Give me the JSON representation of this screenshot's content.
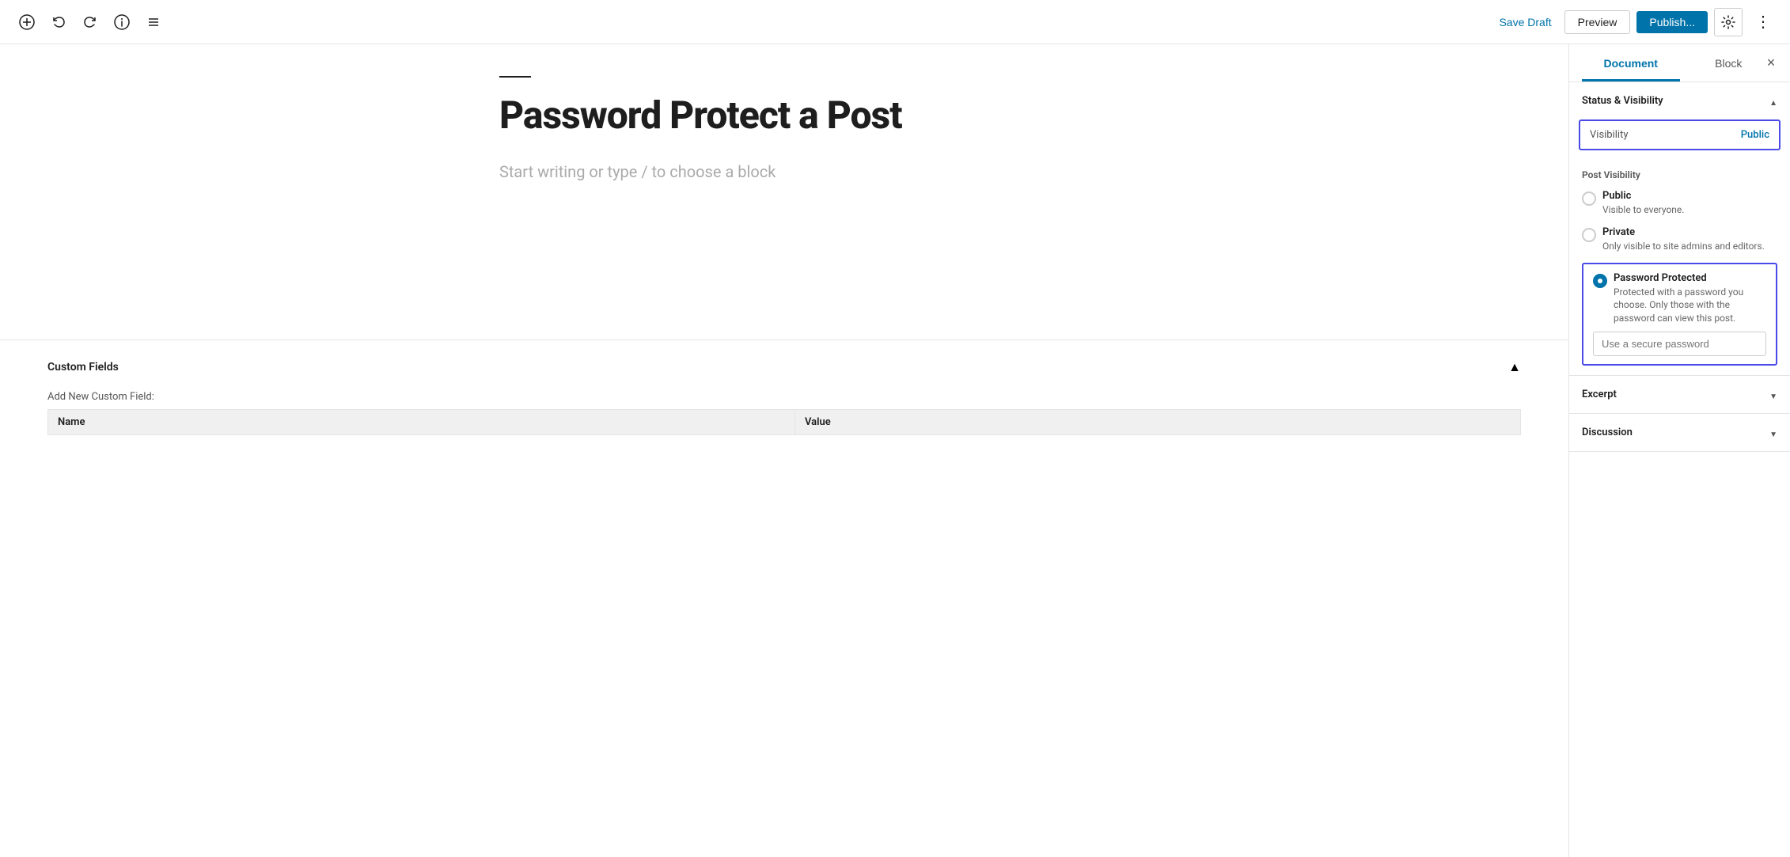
{
  "toolbar": {
    "save_draft_label": "Save Draft",
    "preview_label": "Preview",
    "publish_label": "Publish...",
    "more_label": "⋮"
  },
  "sidebar": {
    "document_tab": "Document",
    "block_tab": "Block",
    "close_label": "×",
    "status_visibility": {
      "title": "Status & Visibility",
      "visibility_label": "Visibility",
      "visibility_value": "Public",
      "post_visibility_title": "Post Visibility",
      "options": [
        {
          "id": "public",
          "title": "Public",
          "desc": "Visible to everyone.",
          "checked": false
        },
        {
          "id": "private",
          "title": "Private",
          "desc": "Only visible to site admins and editors.",
          "checked": false
        },
        {
          "id": "password",
          "title": "Password Protected",
          "desc": "Protected with a password you choose. Only those with the password can view this post.",
          "checked": true
        }
      ],
      "password_placeholder": "Use a secure password"
    },
    "excerpt": {
      "title": "Excerpt"
    },
    "discussion": {
      "title": "Discussion"
    }
  },
  "editor": {
    "title": "Password Protect a Post",
    "placeholder": "Start writing or type / to choose a block"
  },
  "custom_fields": {
    "title": "Custom Fields",
    "add_new_label": "Add New Custom Field:",
    "col_name": "Name",
    "col_value": "Value"
  }
}
